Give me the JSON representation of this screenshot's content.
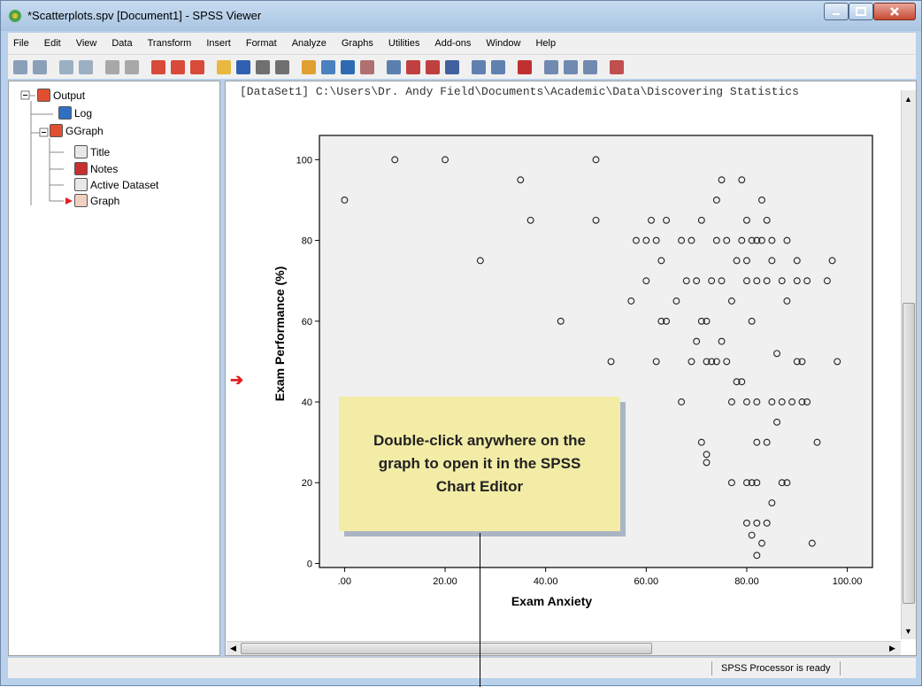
{
  "window": {
    "title": "*Scatterplots.spv [Document1] - SPSS Viewer"
  },
  "menu": [
    "File",
    "Edit",
    "View",
    "Data",
    "Transform",
    "Insert",
    "Format",
    "Analyze",
    "Graphs",
    "Utilities",
    "Add-ons",
    "Window",
    "Help"
  ],
  "outline": {
    "items": [
      "Output",
      "Log",
      "GGraph",
      "Title",
      "Notes",
      "Active Dataset",
      "Graph"
    ]
  },
  "content": {
    "dataset_line": "[DataSet1] C:\\Users\\Dr. Andy Field\\Documents\\Academic\\Data\\Discovering Statistics"
  },
  "callout": {
    "text": "Double-click anywhere on the graph to open it in the SPSS Chart Editor"
  },
  "status": {
    "text": "SPSS  Processor is ready"
  },
  "colors": {
    "selection_arrow": "#e02020",
    "callout_bg": "#f3eca6",
    "plot_bg": "#f0f0f0"
  },
  "chart_data": {
    "type": "scatter",
    "xlabel": "Exam Anxiety",
    "ylabel": "Exam Performance (%)",
    "xlim": [
      0,
      100
    ],
    "ylim": [
      0,
      100
    ],
    "x_tick_labels": [
      ".00",
      "20.00",
      "40.00",
      "60.00",
      "80.00",
      "100.00"
    ],
    "y_tick_labels": [
      "0",
      "20",
      "40",
      "60",
      "80",
      "100"
    ],
    "points": [
      [
        0,
        90
      ],
      [
        10,
        100
      ],
      [
        20,
        100
      ],
      [
        27,
        75
      ],
      [
        35,
        95
      ],
      [
        37,
        85
      ],
      [
        43,
        60
      ],
      [
        50,
        100
      ],
      [
        50,
        85
      ],
      [
        53,
        50
      ],
      [
        57,
        65
      ],
      [
        58,
        80
      ],
      [
        60,
        80
      ],
      [
        60,
        70
      ],
      [
        61,
        85
      ],
      [
        62,
        80
      ],
      [
        62,
        50
      ],
      [
        63,
        75
      ],
      [
        63,
        60
      ],
      [
        64,
        85
      ],
      [
        64,
        60
      ],
      [
        66,
        65
      ],
      [
        67,
        80
      ],
      [
        67,
        40
      ],
      [
        68,
        70
      ],
      [
        69,
        80
      ],
      [
        69,
        50
      ],
      [
        70,
        70
      ],
      [
        70,
        55
      ],
      [
        71,
        85
      ],
      [
        71,
        60
      ],
      [
        71,
        30
      ],
      [
        72,
        50
      ],
      [
        72,
        60
      ],
      [
        72,
        27
      ],
      [
        72,
        25
      ],
      [
        73,
        50
      ],
      [
        73,
        70
      ],
      [
        74,
        80
      ],
      [
        74,
        50
      ],
      [
        74,
        90
      ],
      [
        75,
        70
      ],
      [
        75,
        95
      ],
      [
        75,
        55
      ],
      [
        76,
        50
      ],
      [
        76,
        80
      ],
      [
        77,
        65
      ],
      [
        77,
        40
      ],
      [
        77,
        20
      ],
      [
        78,
        75
      ],
      [
        78,
        45
      ],
      [
        79,
        95
      ],
      [
        79,
        80
      ],
      [
        79,
        45
      ],
      [
        80,
        75
      ],
      [
        80,
        85
      ],
      [
        80,
        70
      ],
      [
        80,
        40
      ],
      [
        80,
        20
      ],
      [
        80,
        10
      ],
      [
        81,
        80
      ],
      [
        81,
        60
      ],
      [
        81,
        20
      ],
      [
        81,
        7
      ],
      [
        82,
        80
      ],
      [
        82,
        70
      ],
      [
        82,
        40
      ],
      [
        82,
        30
      ],
      [
        82,
        20
      ],
      [
        82,
        10
      ],
      [
        82,
        2
      ],
      [
        83,
        80
      ],
      [
        83,
        90
      ],
      [
        83,
        5
      ],
      [
        84,
        85
      ],
      [
        84,
        70
      ],
      [
        84,
        30
      ],
      [
        84,
        10
      ],
      [
        85,
        80
      ],
      [
        85,
        40
      ],
      [
        85,
        15
      ],
      [
        85,
        75
      ],
      [
        86,
        52
      ],
      [
        86,
        35
      ],
      [
        87,
        70
      ],
      [
        87,
        20
      ],
      [
        87,
        40
      ],
      [
        88,
        80
      ],
      [
        88,
        65
      ],
      [
        88,
        20
      ],
      [
        89,
        40
      ],
      [
        90,
        75
      ],
      [
        90,
        70
      ],
      [
        90,
        50
      ],
      [
        91,
        50
      ],
      [
        91,
        40
      ],
      [
        92,
        70
      ],
      [
        92,
        40
      ],
      [
        93,
        5
      ],
      [
        94,
        30
      ],
      [
        96,
        70
      ],
      [
        97,
        75
      ],
      [
        98,
        50
      ]
    ]
  }
}
